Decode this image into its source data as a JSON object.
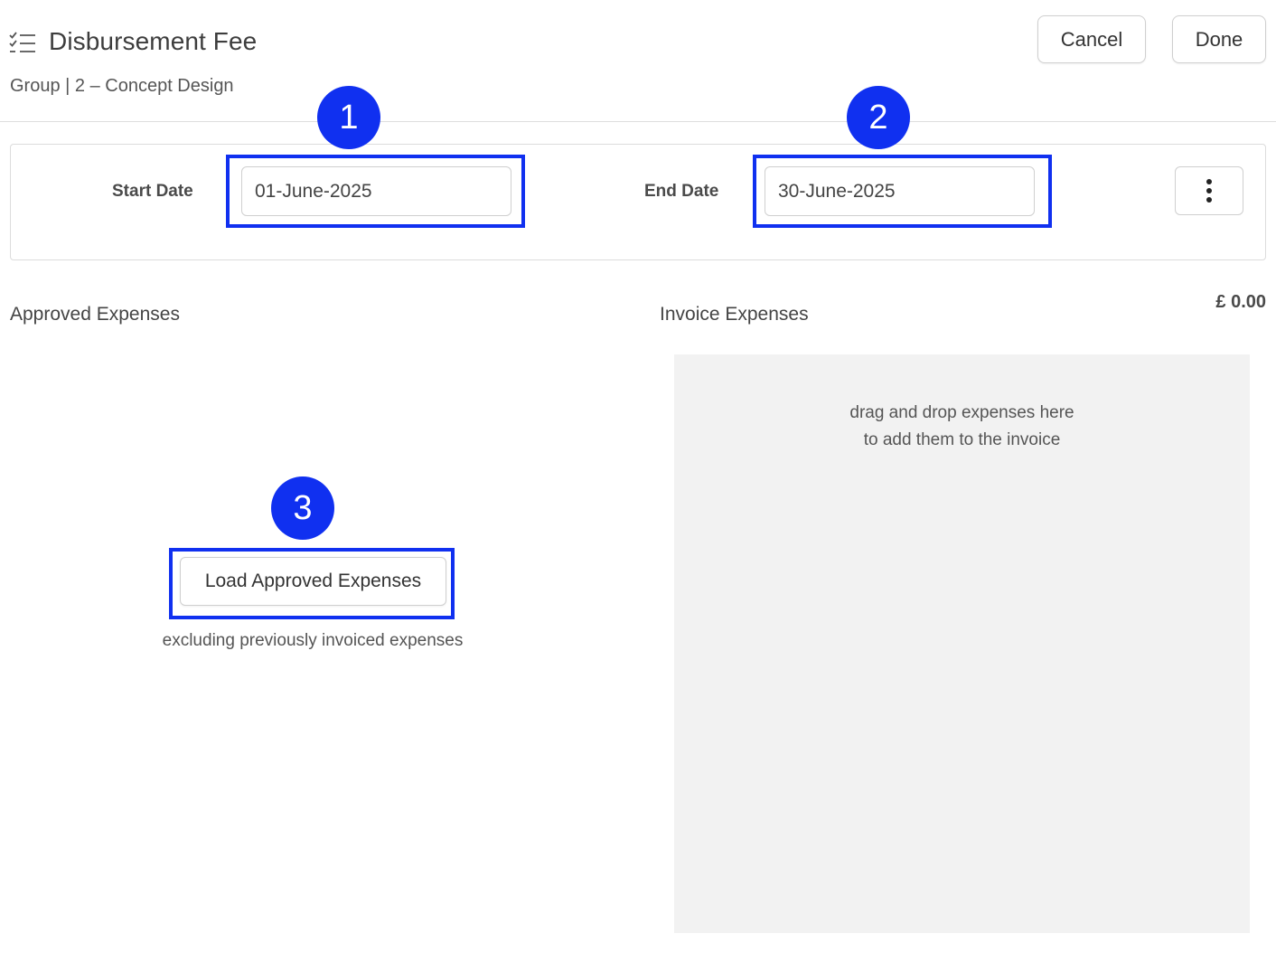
{
  "header": {
    "icon": "checklist-icon",
    "title": "Disbursement Fee",
    "subtitle": "Group | 2 – Concept Design",
    "cancel_label": "Cancel",
    "done_label": "Done"
  },
  "dates": {
    "start_label": "Start Date",
    "start_value": "01-June-2025",
    "end_label": "End Date",
    "end_value": "30-June-2025",
    "more_icon": "vertical-ellipsis-icon"
  },
  "annotations": {
    "badge_1": "1",
    "badge_2": "2",
    "badge_3": "3",
    "highlight_color": "#1030f0"
  },
  "approved": {
    "title": "Approved Expenses",
    "load_button_label": "Load Approved Expenses",
    "load_note": "excluding previously invoiced expenses"
  },
  "invoice": {
    "title": "Invoice Expenses",
    "total": "£ 0.00",
    "drop_line_1": "drag and drop expenses here",
    "drop_line_2": "to add them to the invoice"
  }
}
